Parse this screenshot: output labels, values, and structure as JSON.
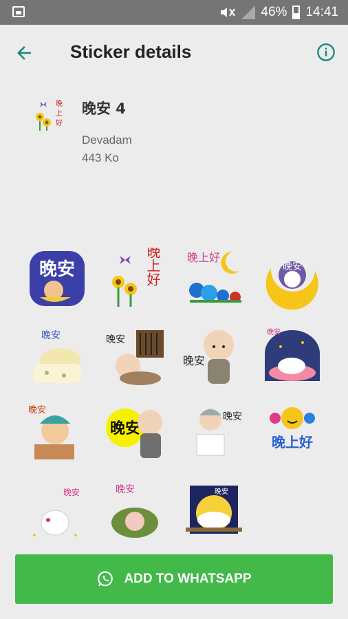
{
  "status_bar": {
    "battery": "46%",
    "time": "14:41"
  },
  "app_bar": {
    "title": "Sticker details",
    "back_icon": "back-arrow-icon",
    "info_icon": "info-icon"
  },
  "pack": {
    "name": "晚安 4",
    "author": "Devadam",
    "size": "443 Ko",
    "thumb_text": "晚上好"
  },
  "stickers": [
    {
      "text": "晚安"
    },
    {
      "text": "晚上好"
    },
    {
      "text": "晚上好"
    },
    {
      "text": "晚安"
    },
    {
      "text": "晚安"
    },
    {
      "text": "晚安"
    },
    {
      "text": "晚安"
    },
    {
      "text": "晚安"
    },
    {
      "text": "晚安"
    },
    {
      "text": "晚安"
    },
    {
      "text": "晚安"
    },
    {
      "text": "晚上好"
    },
    {
      "text": "晚安"
    },
    {
      "text": "晚安"
    },
    {
      "text": "晚安"
    }
  ],
  "add_button": {
    "label": "ADD TO WHATSAPP",
    "icon": "whatsapp-icon"
  },
  "colors": {
    "accent": "#16887a",
    "button": "#43b94a"
  }
}
